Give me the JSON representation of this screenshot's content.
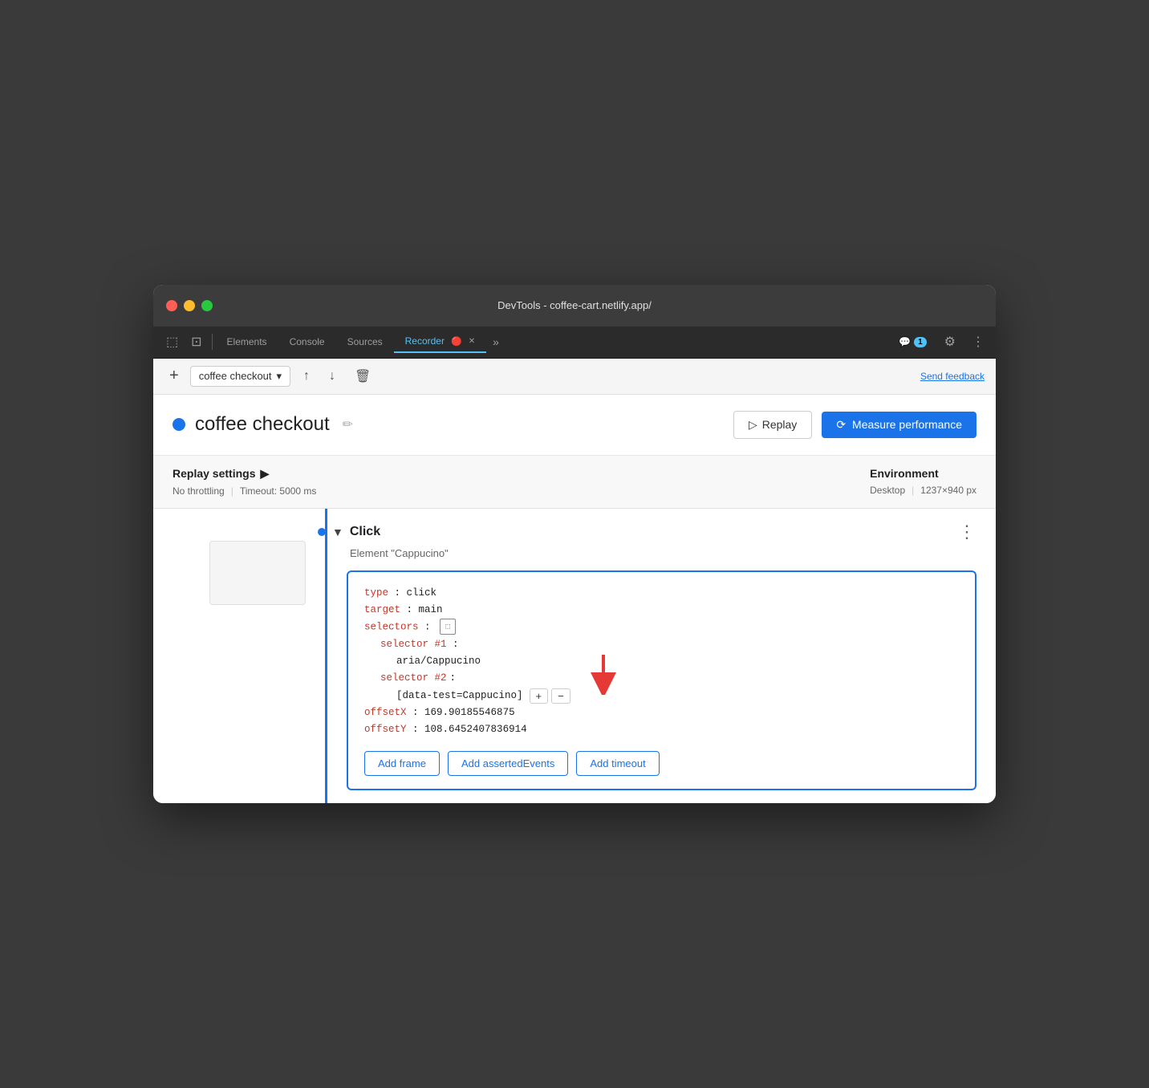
{
  "window": {
    "title": "DevTools - coffee-cart.netlify.app/"
  },
  "tabbar": {
    "tabs": [
      {
        "label": "Elements",
        "active": false
      },
      {
        "label": "Console",
        "active": false
      },
      {
        "label": "Sources",
        "active": false
      },
      {
        "label": "Recorder",
        "active": true
      },
      {
        "label": "»",
        "active": false
      }
    ],
    "badge_label": "1",
    "settings_icon": "⚙",
    "more_icon": "⋮"
  },
  "toolbar": {
    "add_icon": "+",
    "recording_name": "coffee checkout",
    "dropdown_icon": "▾",
    "export_icon": "↑",
    "import_icon": "↓",
    "delete_icon": "🗑",
    "send_feedback": "Send feedback"
  },
  "header": {
    "recording_name": "coffee checkout",
    "edit_icon": "✏",
    "replay_label": "Replay",
    "measure_label": "Measure performance"
  },
  "settings": {
    "replay_settings_label": "Replay settings",
    "throttling": "No throttling",
    "timeout": "Timeout: 5000 ms",
    "environment_label": "Environment",
    "desktop_label": "Desktop",
    "resolution": "1237×940 px"
  },
  "step": {
    "type": "Click",
    "element": "Element \"Cappucino\"",
    "code": {
      "type_key": "type",
      "type_val": "click",
      "target_key": "target",
      "target_val": "main",
      "selectors_key": "selectors",
      "selector1_key": "selector #1",
      "selector1_val": "aria/Cappucino",
      "selector2_key": "selector #2",
      "selector2_val": "[data-test=Cappucino]",
      "offsetX_key": "offsetX",
      "offsetX_val": "169.90185546875",
      "offsetY_key": "offsetY",
      "offsetY_val": "108.6452407836914"
    },
    "add_frame": "Add frame",
    "add_asserted_events": "Add assertedEvents",
    "add_timeout": "Add timeout"
  }
}
